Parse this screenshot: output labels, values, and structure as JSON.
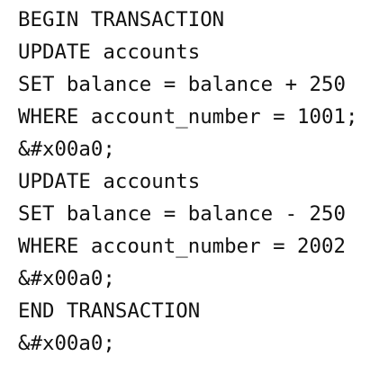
{
  "code_lines": [
    "BEGIN TRANSACTION",
    "UPDATE accounts",
    "SET balance = balance + 250",
    "WHERE account_number = 1001;",
    "&#x00a0;",
    "UPDATE accounts",
    "SET balance = balance - 250",
    "WHERE account_number = 2002",
    "&#x00a0;",
    "END TRANSACTION",
    "&#x00a0;"
  ]
}
